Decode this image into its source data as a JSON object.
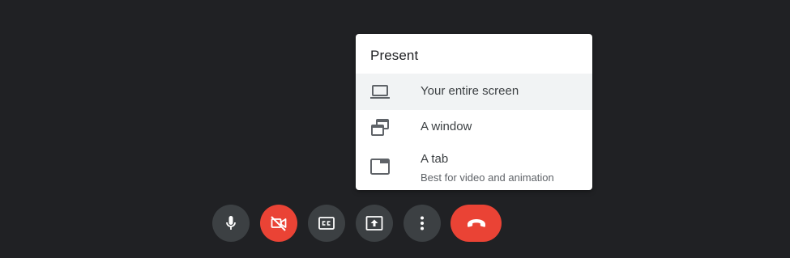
{
  "present_menu": {
    "title": "Present",
    "items": [
      {
        "label": "Your entire screen",
        "icon": "laptop-icon",
        "highlighted": true
      },
      {
        "label": "A window",
        "icon": "window-icon",
        "highlighted": false
      },
      {
        "label": "A tab",
        "sublabel": "Best for video and animation",
        "icon": "tab-icon",
        "highlighted": false
      }
    ]
  },
  "controls": [
    {
      "name": "microphone",
      "icon": "mic-icon",
      "color": "#3c4043"
    },
    {
      "name": "camera-off",
      "icon": "videocam-off-icon",
      "color": "#ea4335"
    },
    {
      "name": "captions",
      "icon": "closed-caption-icon",
      "color": "#3c4043"
    },
    {
      "name": "present-now",
      "icon": "present-to-all-icon",
      "color": "#3c4043"
    },
    {
      "name": "more-options",
      "icon": "more-vert-icon",
      "color": "#3c4043"
    },
    {
      "name": "leave-call",
      "icon": "call-end-icon",
      "color": "#ea4335"
    }
  ],
  "colors": {
    "background": "#202124",
    "menu_bg": "#ffffff",
    "highlight_bg": "#f1f3f4",
    "button_dark": "#3c4043",
    "button_red": "#ea4335"
  }
}
